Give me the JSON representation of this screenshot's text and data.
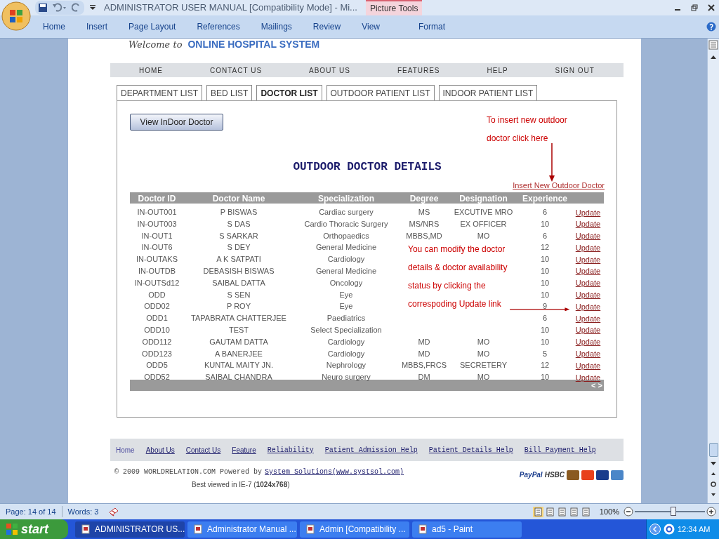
{
  "window": {
    "title": "ADMINISTRATOR USER MANUAL [Compatibility Mode] - Mi...",
    "contextual_group": "Picture Tools"
  },
  "ribbon_tabs": [
    {
      "label": "Home",
      "kind": "main"
    },
    {
      "label": "Insert",
      "kind": "main"
    },
    {
      "label": "Page Layout",
      "kind": "main"
    },
    {
      "label": "References",
      "kind": "main"
    },
    {
      "label": "Mailings",
      "kind": "main"
    },
    {
      "label": "Review",
      "kind": "main"
    },
    {
      "label": "View",
      "kind": "main"
    },
    {
      "label": "Format",
      "kind": "contextual"
    }
  ],
  "document": {
    "welcome": {
      "prefix": "Welcome to",
      "name": "ONLINE HOSPITAL SYSTEM"
    },
    "nav_menu": [
      "HOME",
      "CONTACT US",
      "ABOUT US",
      "FEATURES",
      "HELP",
      "SIGN OUT"
    ],
    "tabs": [
      {
        "label": "DEPARTMENT LIST",
        "selected": false
      },
      {
        "label": "BED LIST",
        "selected": false
      },
      {
        "label": "DOCTOR LIST",
        "selected": true
      },
      {
        "label": "OUTDOOR PATIENT LIST",
        "selected": false
      },
      {
        "label": "INDOOR PATIENT LIST",
        "selected": false
      }
    ],
    "view_button": "View InDoor Doctor",
    "heading": "OUTDOOR DOCTOR DETAILS",
    "insert_link": "Insert New Outdoor Doctor",
    "annotations": [
      {
        "lines": [
          "To insert new outdoor",
          "doctor click here"
        ]
      },
      {
        "lines": [
          "You can modify the doctor",
          "details & doctor availability",
          "status by clicking the",
          "correspoding Update link"
        ]
      }
    ],
    "table": {
      "columns": [
        "Doctor ID",
        "Doctor Name",
        "Specialization",
        "Degree",
        "Designation",
        "Experience"
      ],
      "rows": [
        [
          "IN-OUT001",
          "P BISWAS",
          "Cardiac surgery",
          "MS",
          "EXCUTIVE MRO",
          "6",
          "Update"
        ],
        [
          "IN-OUT003",
          "S DAS",
          "Cardio Thoracic Surgery",
          "MS/NRS",
          "EX OFFICER",
          "10",
          "Update"
        ],
        [
          "IN-OUT1",
          "S SARKAR",
          "Orthopaedics",
          "MBBS,MD",
          "MO",
          "6",
          "Update"
        ],
        [
          "IN-OUT6",
          "S DEY",
          "General Medicine",
          "",
          "",
          "12",
          "Update"
        ],
        [
          "IN-OUTAKS",
          "A K SATPATI",
          "Cardiology",
          "",
          "",
          "10",
          "Update"
        ],
        [
          "IN-OUTDB",
          "DEBASISH BISWAS",
          "General Medicine",
          "",
          "",
          "10",
          "Update"
        ],
        [
          "IN-OUTSd12",
          "SAIBAL DATTA",
          "Oncology",
          "",
          "",
          "10",
          "Update"
        ],
        [
          "ODD",
          "S SEN",
          "Eye",
          "",
          "",
          "10",
          "Update"
        ],
        [
          "ODD02",
          "P ROY",
          "Eye",
          "",
          "",
          "9",
          "Update"
        ],
        [
          "ODD1",
          "TAPABRATA CHATTERJEE",
          "Paediatrics",
          "",
          "",
          "6",
          "Update"
        ],
        [
          "ODD10",
          "TEST",
          "Select Specialization",
          "",
          "",
          "10",
          "Update"
        ],
        [
          "ODD112",
          "GAUTAM DATTA",
          "Cardiology",
          "MD",
          "MO",
          "10",
          "Update"
        ],
        [
          "ODD123",
          "A BANERJEE",
          "Cardiology",
          "MD",
          "MO",
          "5",
          "Update"
        ],
        [
          "ODD5",
          "KUNTAL MAITY JN.",
          "Nephrology",
          "MBBS,FRCS",
          "SECRETERY",
          "12",
          "Update"
        ],
        [
          "ODD52",
          "SAIBAL CHANDRA",
          "Neuro surgery",
          "DM",
          "MO",
          "10",
          "Update"
        ]
      ],
      "pager": "< >"
    },
    "footer_links": [
      {
        "label": "Home",
        "kind": "plain"
      },
      {
        "label": "About Us",
        "kind": "link"
      },
      {
        "label": "Contact Us",
        "kind": "link"
      },
      {
        "label": "Feature",
        "kind": "link"
      },
      {
        "label": "Reliability",
        "kind": "mono"
      },
      {
        "label": "Patient Admission Help",
        "kind": "mono"
      },
      {
        "label": "Patient Details Help",
        "kind": "mono"
      },
      {
        "label": "Bill Payment Help",
        "kind": "mono"
      }
    ],
    "copyright": "© 2009 WORLDRELATION.COM Powered by",
    "powered_link": "System Solutions(www.systsol.com)",
    "best_viewed": "Best viewed in IE-7 (**1024x768**)",
    "payment_logos": [
      {
        "kind": "text",
        "label": "PayPal",
        "color": "#1a3c8c"
      },
      {
        "kind": "text",
        "label": "HSBC",
        "color": "#333333"
      },
      {
        "kind": "card",
        "color": "#8a5a20"
      },
      {
        "kind": "card",
        "color": "#e8401c"
      },
      {
        "kind": "card",
        "color": "#1a3c8c"
      },
      {
        "kind": "card",
        "color": "#4a86c8"
      }
    ]
  },
  "status_bar": {
    "page": "Page: 14 of 14",
    "words": "Words: 3",
    "zoom": "100%",
    "zoom_slider": {
      "level": 0.55
    }
  },
  "taskbar": {
    "start": "start",
    "tasks": [
      {
        "label": "ADMINISTRATOR US...",
        "selected": true
      },
      {
        "label": "Administrator Manual ...",
        "selected": false
      },
      {
        "label": "Admin [Compatibility ...",
        "selected": false
      },
      {
        "label": "ad5 - Paint",
        "selected": false
      }
    ],
    "clock": "12:34 AM"
  }
}
